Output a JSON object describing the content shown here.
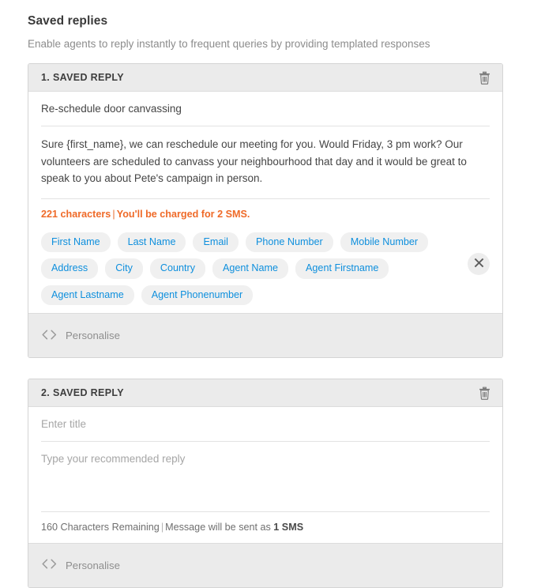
{
  "page": {
    "title": "Saved replies",
    "subtitle": "Enable agents to reply instantly to frequent queries by providing templated responses"
  },
  "colors": {
    "accent_blue": "#0e8fdd",
    "warning_orange": "#ef6a28",
    "header_gray": "#ebebeb",
    "tag_bg": "#f0f0f0",
    "border": "#d4d4d4",
    "body_text": "#454545",
    "muted_text": "#8c8c8c"
  },
  "icons": {
    "trash": "trash-icon",
    "close": "close-icon",
    "code": "code-brackets-icon"
  },
  "cards": [
    {
      "header_title": "1. SAVED REPLY",
      "delete_label": "Delete saved reply",
      "title_value": "Re-schedule door canvassing",
      "title_placeholder": "Enter title",
      "body_value": "Sure {first_name}, we can reschedule our meeting for you. Would Friday, 3 pm work? Our volunteers are scheduled to canvass your neighbourhood that day and it would be great to speak to you about Pete's campaign in person.",
      "body_placeholder": "Type your recommended reply",
      "counter_count": "221 characters",
      "counter_sep": "|",
      "counter_message": "You'll be charged for 2 SMS.",
      "tags_visible": true,
      "tags": [
        "First Name",
        "Last Name",
        "Email",
        "Phone Number",
        "Mobile Number",
        "Address",
        "City",
        "Country",
        "Agent Name",
        "Agent Firstname",
        "Agent Lastname",
        "Agent Phonenumber"
      ],
      "footer_label": "Personalise"
    },
    {
      "header_title": "2.  SAVED REPLY",
      "delete_label": "Delete saved reply",
      "title_value": "",
      "title_placeholder": "Enter title",
      "body_value": "",
      "body_placeholder": "Type your recommended reply",
      "counter_count": "160 Characters Remaining",
      "counter_sep": "|",
      "counter_message_prefix": "Message will be sent as ",
      "counter_message_strong": "1 SMS",
      "tags_visible": false,
      "footer_label": "Personalise"
    }
  ]
}
